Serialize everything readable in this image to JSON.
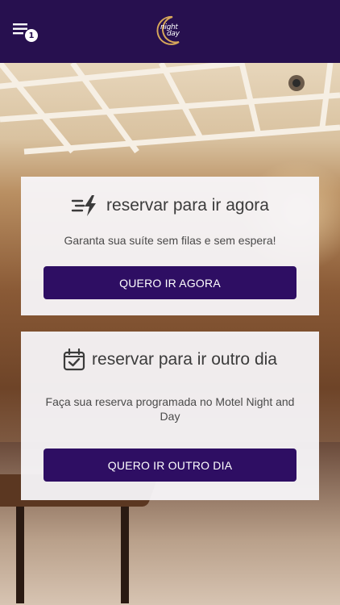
{
  "header": {
    "menu_badge_count": "1",
    "logo_lines": [
      "night",
      "day"
    ]
  },
  "cards": {
    "now": {
      "title": "reservar para ir agora",
      "subtitle": "Garanta sua suíte sem filas e sem espera!",
      "button": "QUERO IR AGORA"
    },
    "other_day": {
      "title": "reservar para ir outro dia",
      "subtitle": "Faça sua reserva programada no Motel Night and Day",
      "button": "QUERO IR OUTRO DIA"
    }
  },
  "colors": {
    "brand_purple": "#27104f",
    "button_purple": "#2e0e63",
    "moon_gold": "#d6a75a"
  },
  "icons": {
    "menu": "hamburger-menu-icon",
    "now": "lightning-fast-icon",
    "other_day": "calendar-check-icon"
  }
}
